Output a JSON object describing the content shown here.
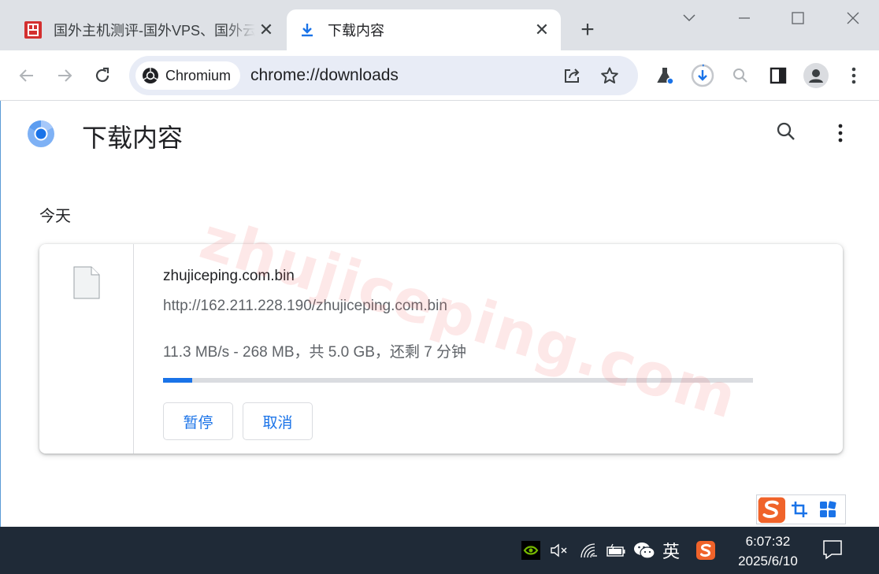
{
  "tabs": [
    {
      "title": "国外主机测评-国外VPS、国外云",
      "active": false
    },
    {
      "title": "下载内容",
      "active": true
    }
  ],
  "omnibox": {
    "chip_label": "Chromium",
    "url": "chrome://downloads"
  },
  "page": {
    "title": "下载内容",
    "date_heading": "今天"
  },
  "download": {
    "filename": "zhujiceping.com.bin",
    "url": "http://162.211.228.190/zhujiceping.com.bin",
    "status": "11.3 MB/s - 268 MB，共 5.0 GB，还剩 7 分钟",
    "progress_fraction": 0.05,
    "pause_label": "暂停",
    "cancel_label": "取消"
  },
  "watermark": "zhujiceping.com",
  "taskbar": {
    "ime_lang": "英",
    "time": "6:07:32",
    "date": "2025/6/10"
  },
  "colors": {
    "accent": "#1a73e8",
    "tabstrip": "#dee1e6",
    "omnibox": "#e8ecf6",
    "taskbar": "#1f2a37"
  }
}
